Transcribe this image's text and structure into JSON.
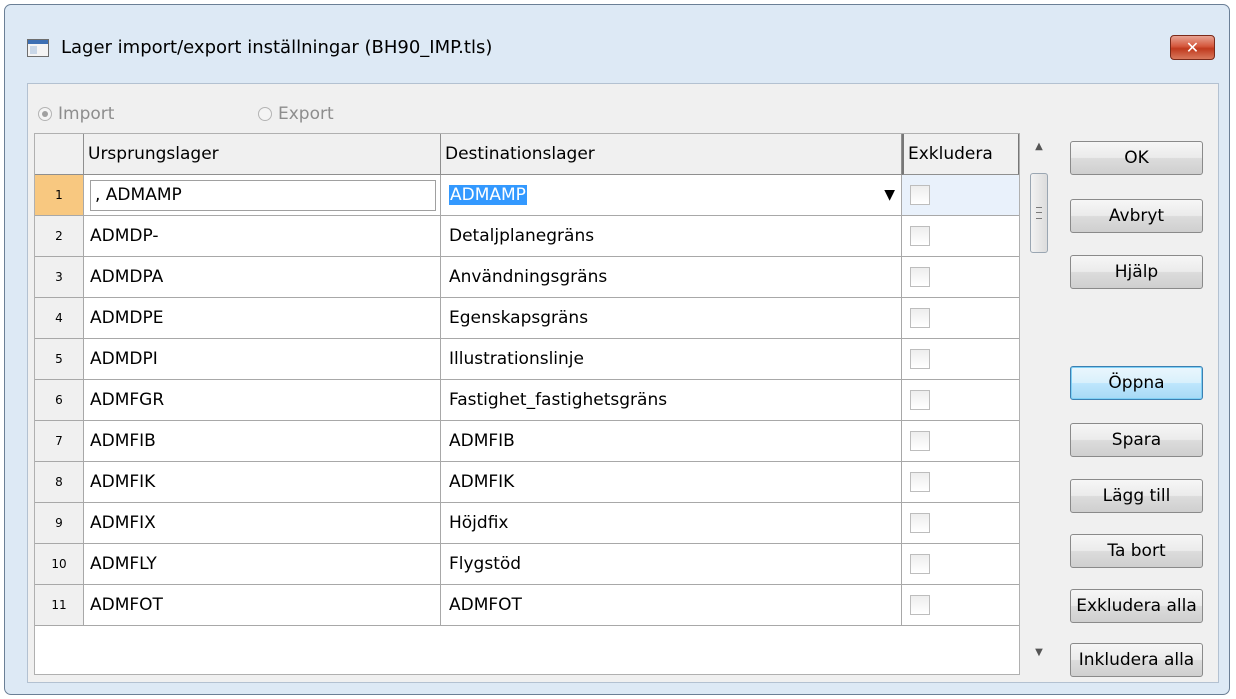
{
  "window": {
    "title": "Lager import/export inställningar (BH90_IMP.tls)",
    "close_label": "✕"
  },
  "mode": {
    "import_label": "Import",
    "export_label": "Export",
    "selected": "Import"
  },
  "table": {
    "columns": [
      "Ursprungslager",
      "Destinationslager",
      "Exkludera"
    ],
    "rows": [
      {
        "num": "1",
        "source": ", ADMAMP",
        "dest": "ADMAMP"
      },
      {
        "num": "2",
        "source": "ADMDP-",
        "dest": "Detaljplanegräns"
      },
      {
        "num": "3",
        "source": "ADMDPA",
        "dest": "Användningsgräns"
      },
      {
        "num": "4",
        "source": "ADMDPE",
        "dest": "Egenskapsgräns"
      },
      {
        "num": "5",
        "source": "ADMDPI",
        "dest": "Illustrationslinje"
      },
      {
        "num": "6",
        "source": "ADMFGR",
        "dest": "Fastighet_fastighetsgräns"
      },
      {
        "num": "7",
        "source": "ADMFIB",
        "dest": "ADMFIB"
      },
      {
        "num": "8",
        "source": "ADMFIK",
        "dest": "ADMFIK"
      },
      {
        "num": "9",
        "source": "ADMFIX",
        "dest": "Höjdfix"
      },
      {
        "num": "10",
        "source": "ADMFLY",
        "dest": "Flygstöd"
      },
      {
        "num": "11",
        "source": "ADMFOT",
        "dest": "ADMFOT"
      }
    ]
  },
  "buttons": {
    "ok": "OK",
    "cancel": "Avbryt",
    "help": "Hjälp",
    "open": "Öppna",
    "save": "Spara",
    "add": "Lägg till",
    "remove": "Ta bort",
    "exclude_all": "Exkludera alla",
    "include_all": "Inkludera alla"
  }
}
